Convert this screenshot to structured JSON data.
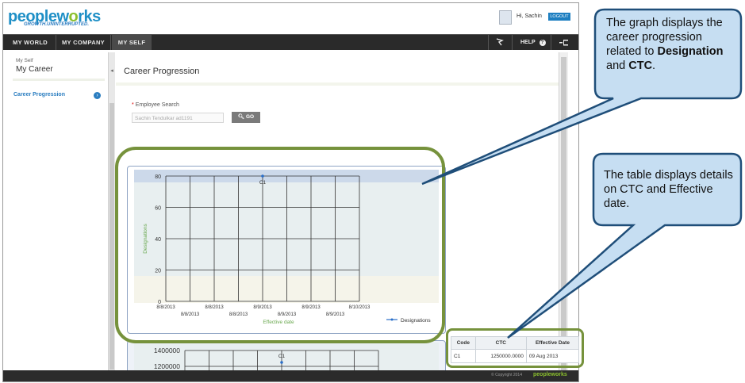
{
  "header": {
    "logo_text_a": "peoplew",
    "logo_text_b": "o",
    "logo_text_c": "rks",
    "tagline": "GROWTH.UNINTERRUPTED.",
    "greeting": "Hi, Sachin",
    "logout_label": "LOGOUT"
  },
  "nav": {
    "items": [
      "MY WORLD",
      "MY COMPANY",
      "MY SELF"
    ],
    "help_label": "HELP"
  },
  "sidebar": {
    "subtitle": "My Self",
    "title": "My Career",
    "link_label": "Career Progression"
  },
  "main": {
    "page_title": "Career Progression",
    "employee_search_label": "Employee Search",
    "required_mark": "*",
    "employee_search_value": "Sachin Tendulkar ad1191",
    "go_label": "GO"
  },
  "chart_data": [
    {
      "type": "line",
      "title": "",
      "xlabel": "Effective date",
      "ylabel": "Designations",
      "ylim": [
        0,
        80
      ],
      "yticks": [
        0,
        20,
        40,
        60,
        80
      ],
      "x_tick_labels_upper": [
        "8/8/2013",
        "8/8/2013",
        "8/9/2013",
        "8/9/2013",
        "8/10/2013"
      ],
      "x_tick_labels_lower": [
        "8/8/2013",
        "8/8/2013",
        "8/9/2013",
        "8/9/2013"
      ],
      "series": [
        {
          "name": "Designations",
          "points": [
            {
              "x": "8/9/2013",
              "y": 80,
              "label": "C1"
            }
          ]
        }
      ],
      "legend": "bottom-right",
      "grid": true
    },
    {
      "type": "line",
      "title": "",
      "yticks": [
        1400000,
        1200000
      ],
      "series": [
        {
          "points": [
            {
              "y": 1250000,
              "label": "C1"
            }
          ]
        }
      ],
      "grid": true
    }
  ],
  "table": {
    "headers": [
      "Code",
      "CTC",
      "Effective Date"
    ],
    "rows": [
      [
        "C1",
        "1250000.0000",
        "09 Aug 2013"
      ]
    ]
  },
  "footer": {
    "copyright": "© Copyright 2014",
    "logo": "peopleworks"
  },
  "callouts": {
    "graph_a": "The graph displays the career progression related to ",
    "graph_b": "Designation",
    "graph_c": " and ",
    "graph_d": "CTC",
    "graph_e": ".",
    "table_text": "The table displays details on CTC and Effective date."
  },
  "colors": {
    "brand_blue": "#1e8fc6",
    "brand_green": "#8bbf2e",
    "highlight_green": "#76923c",
    "callout_fill": "#c6def2",
    "callout_border": "#1f4e79",
    "nav_bg": "#2a2a2a"
  }
}
